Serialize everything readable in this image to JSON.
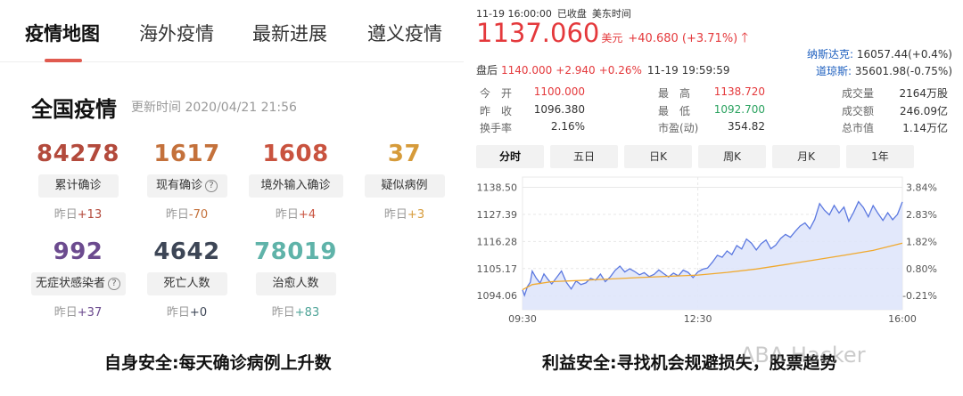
{
  "left": {
    "tabs": [
      {
        "label": "疫情地图",
        "active": true
      },
      {
        "label": "海外疫情",
        "active": false
      },
      {
        "label": "最新进展",
        "active": false
      },
      {
        "label": "遵义疫情",
        "active": false
      }
    ],
    "section_title": "全国疫情",
    "update_time": "更新时间 2020/04/21 21:56",
    "stats": [
      {
        "value": "84278",
        "label": "累计确诊",
        "help": false,
        "yday_prefix": "昨日",
        "yday_delta": "+13",
        "color": "#b34a3c",
        "delta_color": "#b34a3c"
      },
      {
        "value": "1617",
        "label": "现有确诊",
        "help": true,
        "yday_prefix": "昨日",
        "yday_delta": "-70",
        "color": "#c4713b",
        "delta_color": "#c4713b"
      },
      {
        "value": "1608",
        "label": "境外输入确诊",
        "help": false,
        "yday_prefix": "昨日",
        "yday_delta": "+4",
        "color": "#c9533f",
        "delta_color": "#c9533f"
      },
      {
        "value": "37",
        "label": "疑似病例",
        "help": false,
        "yday_prefix": "昨日",
        "yday_delta": "+3",
        "color": "#d69b3a",
        "delta_color": "#d69b3a"
      },
      {
        "value": "992",
        "label": "无症状感染者",
        "help": true,
        "yday_prefix": "昨日",
        "yday_delta": "+37",
        "color": "#6c4b8f",
        "delta_color": "#6c4b8f"
      },
      {
        "value": "4642",
        "label": "死亡人数",
        "help": false,
        "yday_prefix": "昨日",
        "yday_delta": "+0",
        "color": "#3d4656",
        "delta_color": "#3d4656"
      },
      {
        "value": "78019",
        "label": "治愈人数",
        "help": false,
        "yday_prefix": "昨日",
        "yday_delta": "+83",
        "color": "#5fb3a9",
        "delta_color": "#4fa498"
      }
    ],
    "caption": "自身安全:每天确诊病例上升数"
  },
  "right": {
    "header": {
      "datetime": "11-19 16:00:00",
      "status": "已收盘",
      "tz": "美东时间"
    },
    "price": "1137.060",
    "unit": "美元",
    "change": "+40.680 (+3.71%)",
    "indices": [
      {
        "name": "纳斯达克:",
        "value": "16057.44(+0.4%)"
      },
      {
        "name": "道琼斯:",
        "value": "35601.98(-0.75%)"
      }
    ],
    "after_hours": {
      "label": "盘后",
      "price": "1140.000",
      "change": "+2.940",
      "pct": "+0.26%",
      "time": "11-19 19:59:59"
    },
    "quote_rows": [
      [
        {
          "k": "今　开",
          "v": "1100.000",
          "c": "red"
        },
        {
          "k": "最　高",
          "v": "1138.720",
          "c": "red"
        },
        {
          "k": "成交量",
          "v": "2164万股",
          "c": "dark"
        }
      ],
      [
        {
          "k": "昨　收",
          "v": "1096.380",
          "c": "dark"
        },
        {
          "k": "最　低",
          "v": "1092.700",
          "c": "green"
        },
        {
          "k": "成交额",
          "v": "246.09亿",
          "c": "dark"
        }
      ],
      [
        {
          "k": "换手率",
          "v": "2.16%",
          "c": "dark"
        },
        {
          "k": "市盈(动)",
          "v": "354.82",
          "c": "dark"
        },
        {
          "k": "总市值",
          "v": "1.14万亿",
          "c": "dark"
        }
      ]
    ],
    "period_tabs": [
      {
        "label": "分时",
        "active": true
      },
      {
        "label": "五日",
        "active": false
      },
      {
        "label": "日K",
        "active": false
      },
      {
        "label": "周K",
        "active": false
      },
      {
        "label": "月K",
        "active": false
      },
      {
        "label": "1年",
        "active": false
      }
    ],
    "caption": "利益安全:寻找机会规避损失，股票趋势"
  },
  "chart_data": {
    "type": "area",
    "x_tick_labels": [
      "09:30",
      "12:30",
      "16:00"
    ],
    "x_ticks_minutes": [
      0,
      180,
      390
    ],
    "x_range": [
      0,
      390
    ],
    "ylim": [
      1090.5,
      1140.5
    ],
    "y_tick_labels": [
      "1138.50",
      "1127.39",
      "1116.28",
      "1105.17",
      "1094.06"
    ],
    "y_tick_values": [
      1138.5,
      1127.39,
      1116.28,
      1105.17,
      1094.06
    ],
    "y2_tick_labels": [
      "3.84%",
      "2.83%",
      "1.82%",
      "0.80%",
      "-0.21%"
    ],
    "grid": true,
    "colors": {
      "price": "#5b78e0",
      "avg": "#f0a92e",
      "fill": "#dde4fa",
      "grid": "#e8e8e8"
    },
    "series": [
      {
        "role": "price",
        "x": [
          0,
          2,
          5,
          8,
          10,
          14,
          18,
          22,
          26,
          30,
          35,
          40,
          45,
          50,
          55,
          60,
          65,
          70,
          75,
          80,
          85,
          90,
          95,
          100,
          105,
          110,
          115,
          120,
          125,
          130,
          135,
          140,
          145,
          150,
          155,
          160,
          165,
          170,
          175,
          180,
          185,
          190,
          195,
          200,
          205,
          210,
          215,
          220,
          225,
          230,
          235,
          240,
          245,
          250,
          255,
          260,
          265,
          270,
          275,
          280,
          285,
          290,
          295,
          300,
          305,
          310,
          315,
          320,
          325,
          330,
          335,
          340,
          345,
          350,
          355,
          360,
          365,
          370,
          375,
          380,
          385,
          390
        ],
        "y": [
          1096.4,
          1094.2,
          1097.8,
          1099.5,
          1104.1,
          1101.3,
          1099.2,
          1103.0,
          1100.8,
          1098.9,
          1101.5,
          1104.2,
          1099.5,
          1096.8,
          1100.1,
          1098.6,
          1099.3,
          1101.2,
          1100.4,
          1102.9,
          1099.8,
          1101.7,
          1104.4,
          1106.2,
          1103.8,
          1105.1,
          1104.0,
          1102.6,
          1103.5,
          1101.9,
          1102.8,
          1104.6,
          1103.1,
          1101.7,
          1103.3,
          1102.2,
          1104.5,
          1103.6,
          1101.5,
          1103.8,
          1104.9,
          1105.4,
          1107.8,
          1110.6,
          1109.8,
          1112.4,
          1110.9,
          1114.6,
          1113.2,
          1117.3,
          1115.6,
          1112.8,
          1115.4,
          1116.9,
          1113.3,
          1114.8,
          1117.5,
          1119.2,
          1118.0,
          1120.4,
          1122.6,
          1123.9,
          1121.5,
          1125.3,
          1131.8,
          1129.1,
          1127.2,
          1131.1,
          1128.0,
          1130.4,
          1124.6,
          1128.3,
          1132.6,
          1130.2,
          1126.4,
          1131.0,
          1127.8,
          1124.9,
          1128.1,
          1125.2,
          1127.4,
          1132.5
        ]
      },
      {
        "role": "average",
        "x": [
          0,
          10,
          30,
          60,
          90,
          120,
          150,
          180,
          210,
          240,
          270,
          300,
          330,
          360,
          390
        ],
        "y": [
          1096.5,
          1098.6,
          1099.8,
          1100.3,
          1100.9,
          1101.5,
          1102.0,
          1102.5,
          1103.6,
          1105.0,
          1106.8,
          1108.7,
          1110.6,
          1112.6,
          1115.6
        ]
      }
    ]
  },
  "watermark": "ABA Hacker"
}
